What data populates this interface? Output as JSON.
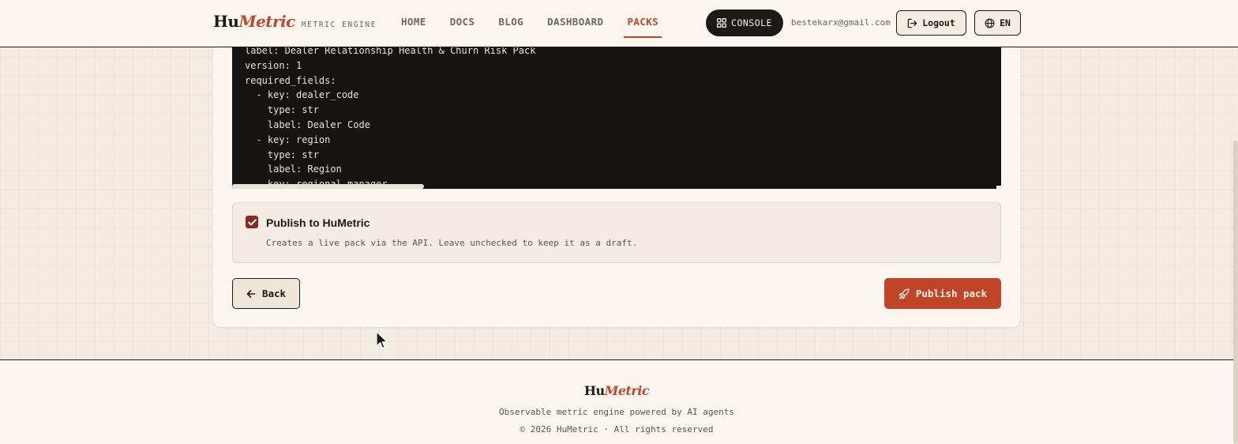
{
  "brand": {
    "hu": "Hu",
    "metric": "Metric",
    "tagline": "METRIC ENGINE"
  },
  "nav": {
    "items": [
      {
        "label": "HOME",
        "active": false
      },
      {
        "label": "DOCS",
        "active": false
      },
      {
        "label": "BLOG",
        "active": false
      },
      {
        "label": "DASHBOARD",
        "active": false
      },
      {
        "label": "PACKS",
        "active": true
      }
    ]
  },
  "header": {
    "console_label": "CONSOLE",
    "user_email": "bestekarx@gmail.com",
    "logout_label": "Logout",
    "language_label": "EN"
  },
  "code_preview": {
    "lines": [
      "label: Dealer Relationship Health & Churn Risk Pack",
      "version: 1",
      "required_fields:",
      "  - key: dealer_code",
      "    type: str",
      "    label: Dealer Code",
      "  - key: region",
      "    type: str",
      "    label: Region",
      "  - key: regional_manager"
    ]
  },
  "publish": {
    "checked": true,
    "title": "Publish to HuMetric",
    "description": "Creates a live pack via the API. Leave unchecked to keep it as a draft."
  },
  "actions": {
    "back_label": "Back",
    "publish_label": "Publish pack"
  },
  "footer": {
    "brand_hu": "Hu",
    "brand_metric": "Metric",
    "tagline": "Observable metric engine powered by AI agents",
    "copyright": "© 2026 HuMetric · All rights reserved"
  },
  "colors": {
    "accent": "#c0472a",
    "ink": "#1c1a17",
    "paper": "#faf6ef",
    "code_bg": "#151410"
  }
}
